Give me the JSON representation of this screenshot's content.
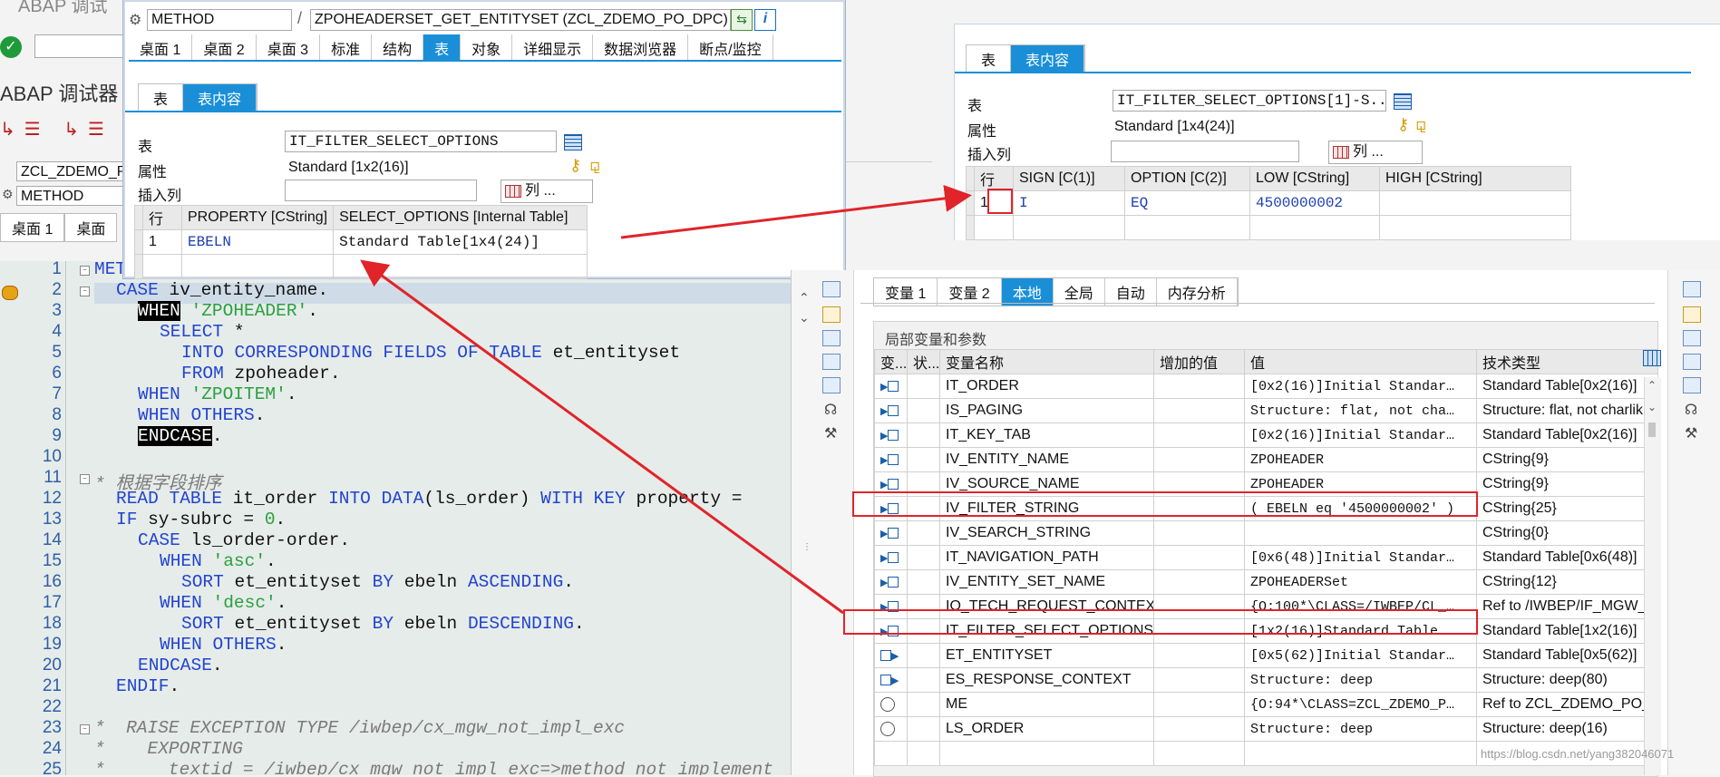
{
  "background": {
    "title_fragment": "ABAP 调试",
    "debugger_label": "ABAP 调试器",
    "class_field": "ZCL_ZDEMO_PO",
    "method_field": "METHOD",
    "bg_tabs": [
      "桌面 1",
      "桌面"
    ]
  },
  "main_window": {
    "object_type": "METHOD",
    "object_name": "ZPOHEADERSET_GET_ENTITYSET (ZCL_ZDEMO_PO_DPC)",
    "tabs": [
      "桌面 1",
      "桌面 2",
      "桌面 3",
      "标准",
      "结构",
      "表",
      "对象",
      "详细显示",
      "数据浏览器",
      "断点/监控"
    ],
    "active_tab": "表",
    "sub_tabs": [
      "表",
      "表内容"
    ],
    "active_sub_tab": "表内容",
    "table_label": "表",
    "table_value": "IT_FILTER_SELECT_OPTIONS",
    "attr_label": "属性",
    "attr_value": "Standard [1x2(16)]",
    "insert_label": "插入列",
    "columns_button": "列 ...",
    "grid": {
      "headers": [
        "行",
        "PROPERTY [CString]",
        "SELECT_OPTIONS [Internal Table]"
      ],
      "rows": [
        {
          "row": "1",
          "property": "EBELN",
          "select_options": "Standard Table[1x4(24)]"
        }
      ]
    }
  },
  "detail_window": {
    "sub_tabs": [
      "表",
      "表内容"
    ],
    "active_sub_tab": "表内容",
    "table_label": "表",
    "table_value": "IT_FILTER_SELECT_OPTIONS[1]-S...",
    "attr_label": "属性",
    "attr_value": "Standard [1x4(24)]",
    "insert_label": "插入列",
    "columns_button": "列 ...",
    "grid": {
      "headers": [
        "行",
        "SIGN [C(1)]",
        "OPTION [C(2)]",
        "LOW [CString]",
        "HIGH [CString]"
      ],
      "rows": [
        {
          "row": "1",
          "sign": "I",
          "option": "EQ",
          "low": "4500000002",
          "high": ""
        }
      ]
    }
  },
  "code_editor": {
    "lines": [
      {
        "n": "1",
        "text": "METHOD zpoheaderset_get_entityset."
      },
      {
        "n": "2",
        "text": "CASE iv_entity_name."
      },
      {
        "n": "3",
        "text": "WHEN 'ZPOHEADER'."
      },
      {
        "n": "4",
        "text": "SELECT *"
      },
      {
        "n": "5",
        "text": "INTO CORRESPONDING FIELDS OF TABLE et_entityset"
      },
      {
        "n": "6",
        "text": "FROM zpoheader."
      },
      {
        "n": "7",
        "text": "WHEN 'ZPOITEM'."
      },
      {
        "n": "8",
        "text": "WHEN OTHERS."
      },
      {
        "n": "9",
        "text": "ENDCASE."
      },
      {
        "n": "10",
        "text": ""
      },
      {
        "n": "11",
        "text": "* 根据字段排序"
      },
      {
        "n": "12",
        "text": "READ TABLE it_order INTO DATA(ls_order) WITH KEY property ="
      },
      {
        "n": "13",
        "text": "IF sy-subrc = 0."
      },
      {
        "n": "14",
        "text": "CASE ls_order-order."
      },
      {
        "n": "15",
        "text": "WHEN 'asc'."
      },
      {
        "n": "16",
        "text": "SORT et_entityset BY ebeln ASCENDING."
      },
      {
        "n": "17",
        "text": "WHEN 'desc'."
      },
      {
        "n": "18",
        "text": "SORT et_entityset BY ebeln DESCENDING."
      },
      {
        "n": "19",
        "text": "WHEN OTHERS."
      },
      {
        "n": "20",
        "text": "ENDCASE."
      },
      {
        "n": "21",
        "text": "ENDIF."
      },
      {
        "n": "22",
        "text": ""
      },
      {
        "n": "23",
        "text": "*  RAISE EXCEPTION TYPE /iwbep/cx_mgw_not_impl_exc"
      },
      {
        "n": "24",
        "text": "*    EXPORTING"
      },
      {
        "n": "25",
        "text": "*      textid = /iwbep/cx_mgw_not_impl_exc=>method_not_implement"
      }
    ]
  },
  "variables_panel": {
    "tabs": [
      "变量 1",
      "变量 2",
      "本地",
      "全局",
      "自动",
      "内存分析"
    ],
    "active_tab": "本地",
    "section_title": "局部变量和参数",
    "headers": [
      "变...",
      "状...",
      "变量名称",
      "增加的值",
      "值",
      "技术类型"
    ],
    "rows": [
      {
        "name": "IT_ORDER",
        "value": "[0x2(16)]Initial Standar…",
        "type": "Standard Table[0x2(16)]",
        "icon": "import"
      },
      {
        "name": "IS_PAGING",
        "value": "Structure: flat, not cha…",
        "type": "Structure: flat, not charlik",
        "icon": "import"
      },
      {
        "name": "IT_KEY_TAB",
        "value": "[0x2(16)]Initial Standar…",
        "type": "Standard Table[0x2(16)]",
        "icon": "import"
      },
      {
        "name": "IV_ENTITY_NAME",
        "value": "ZPOHEADER",
        "type": "CString{9}",
        "icon": "import"
      },
      {
        "name": "IV_SOURCE_NAME",
        "value": "ZPOHEADER",
        "type": "CString{9}",
        "icon": "import"
      },
      {
        "name": "IV_FILTER_STRING",
        "value": "( EBELN eq '4500000002' )",
        "type": "CString{25}",
        "icon": "import"
      },
      {
        "name": "IV_SEARCH_STRING",
        "value": "",
        "type": "CString{0}",
        "icon": "import"
      },
      {
        "name": "IT_NAVIGATION_PATH",
        "value": "[0x6(48)]Initial Standar…",
        "type": "Standard Table[0x6(48)]",
        "icon": "import"
      },
      {
        "name": "IV_ENTITY_SET_NAME",
        "value": "ZPOHEADERSet",
        "type": "CString{12}",
        "icon": "import"
      },
      {
        "name": "IO_TECH_REQUEST_CONTEXT",
        "value": "{O:100*\\CLASS=/IWBEP/CL_…",
        "type": "Ref to /IWBEP/IF_MGW_R",
        "icon": "import"
      },
      {
        "name": "IT_FILTER_SELECT_OPTIONS",
        "value": "[1x2(16)]Standard Table",
        "type": "Standard Table[1x2(16)]",
        "icon": "import"
      },
      {
        "name": "ET_ENTITYSET",
        "value": "[0x5(62)]Initial Standar…",
        "type": "Standard Table[0x5(62)]",
        "icon": "export"
      },
      {
        "name": "ES_RESPONSE_CONTEXT",
        "value": "Structure: deep",
        "type": "Structure: deep(80)",
        "icon": "export"
      },
      {
        "name": "ME",
        "value": "{O:94*\\CLASS=ZCL_ZDEMO_P…",
        "type": "Ref to ZCL_ZDEMO_PO_D",
        "icon": "circle"
      },
      {
        "name": "LS_ORDER",
        "value": "Structure: deep",
        "type": "Structure: deep(16)",
        "icon": "circle"
      }
    ]
  },
  "watermark": "https://blog.csdn.net/yang382046071",
  "colors": {
    "accent": "#1a8fd8",
    "annotation": "#e0242a",
    "keyword": "#2244d0",
    "string": "#2aa040"
  }
}
